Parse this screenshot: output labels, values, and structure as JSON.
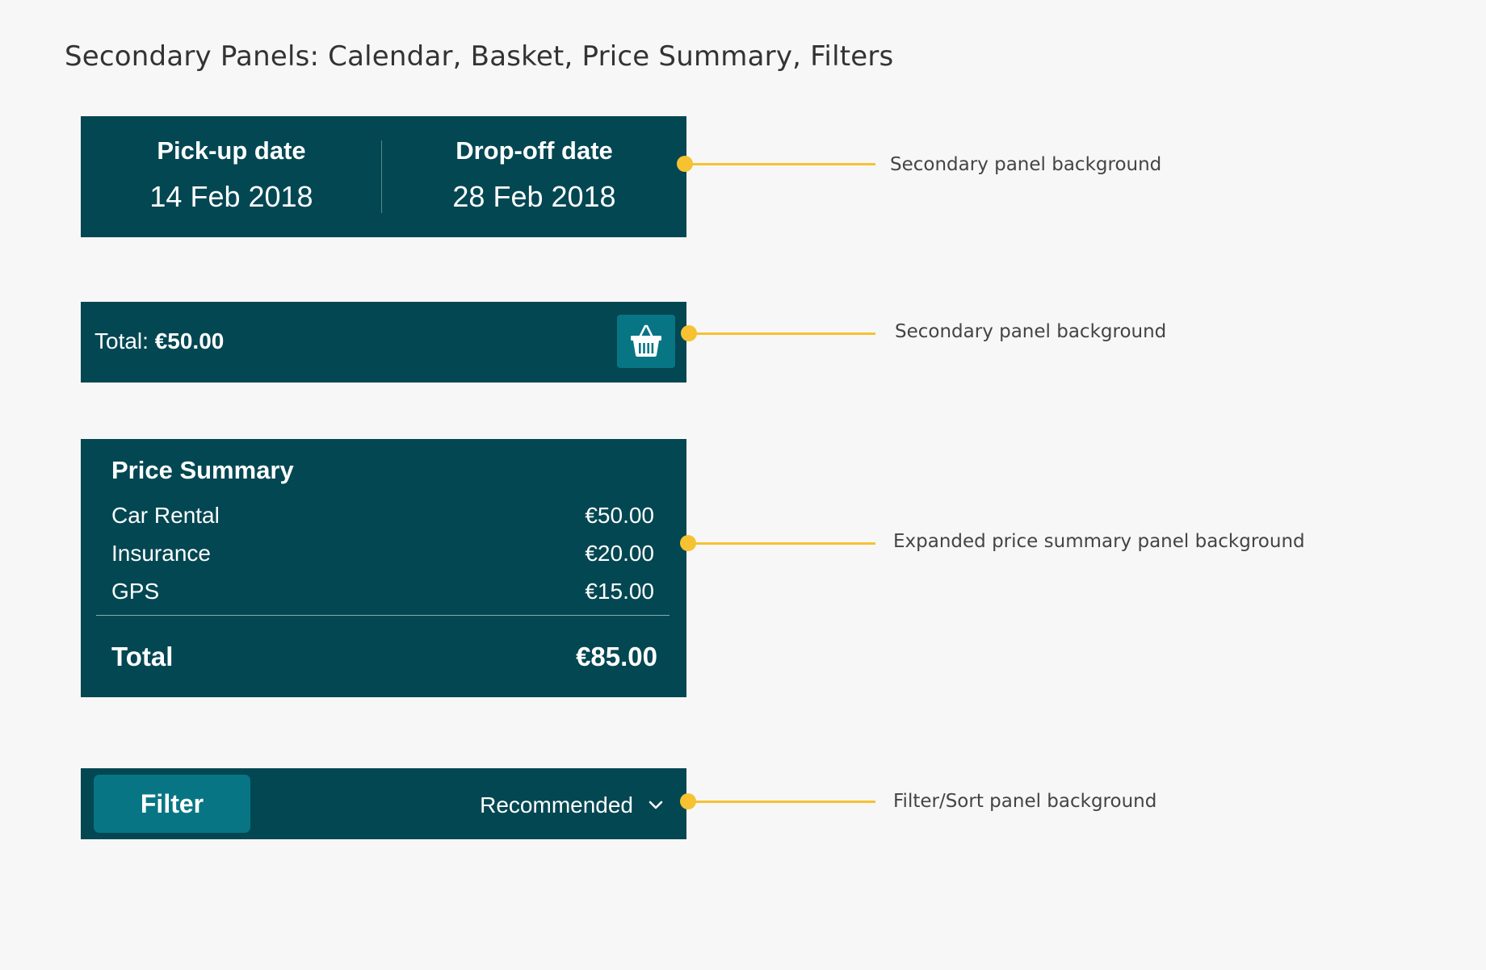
{
  "page": {
    "title": "Secondary Panels: Calendar, Basket, Price Summary, Filters"
  },
  "calendar": {
    "pickup_label": "Pick-up date",
    "pickup_date": "14 Feb 2018",
    "dropoff_label": "Drop-off date",
    "dropoff_date": "28 Feb 2018"
  },
  "basket": {
    "total_label": "Total: ",
    "total_amount": "€50.00",
    "icon": "basket-icon"
  },
  "price_summary": {
    "title": "Price Summary",
    "items": [
      {
        "label": "Car Rental",
        "value": "€50.00"
      },
      {
        "label": "Insurance",
        "value": "€20.00"
      },
      {
        "label": "GPS",
        "value": "€15.00"
      }
    ],
    "total_label": "Total",
    "total_value": "€85.00"
  },
  "filter_bar": {
    "filter_label": "Filter",
    "sort_value": "Recommended",
    "icon": "chevron-down-icon"
  },
  "annotations": [
    {
      "label": "Secondary panel background"
    },
    {
      "label": "Secondary panel background"
    },
    {
      "label": "Expanded price summary panel background"
    },
    {
      "label": "Filter/Sort panel background"
    }
  ],
  "colors": {
    "page_background": "#f7f7f7",
    "panel_background": "#034752",
    "accent_button": "#087584",
    "annotation": "#f6c232",
    "title_text": "#333333"
  }
}
